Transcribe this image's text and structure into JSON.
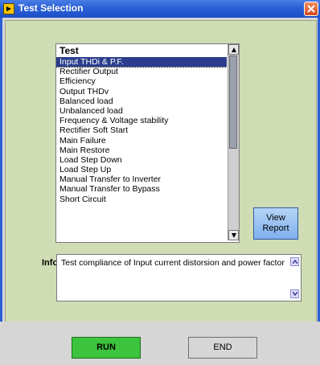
{
  "window": {
    "title": "Test Selection"
  },
  "list": {
    "header": "Test",
    "items": [
      "Input THDi & P.F.",
      "Rectifier Output",
      "Efficiency",
      "Output THDv",
      "Balanced load",
      "Unbalanced load",
      "Frequency & Voltage stability",
      "Rectifier Soft Start",
      "Main Failure",
      "Main Restore",
      "Load Step Down",
      "Load Step Up",
      "Manual Transfer to Inverter",
      "Manual Transfer to Bypass",
      "Short Circuit"
    ],
    "selected_index": 0
  },
  "buttons": {
    "view_report": "View Report",
    "run": "RUN",
    "end": "END"
  },
  "info": {
    "label": "Info:",
    "text": "Test compliance of Input current distorsion and power factor"
  },
  "colors": {
    "panel": "#cfdcb4",
    "selection": "#2b3d8c",
    "run": "#3cc43c",
    "view_report": "#8fbff0"
  }
}
